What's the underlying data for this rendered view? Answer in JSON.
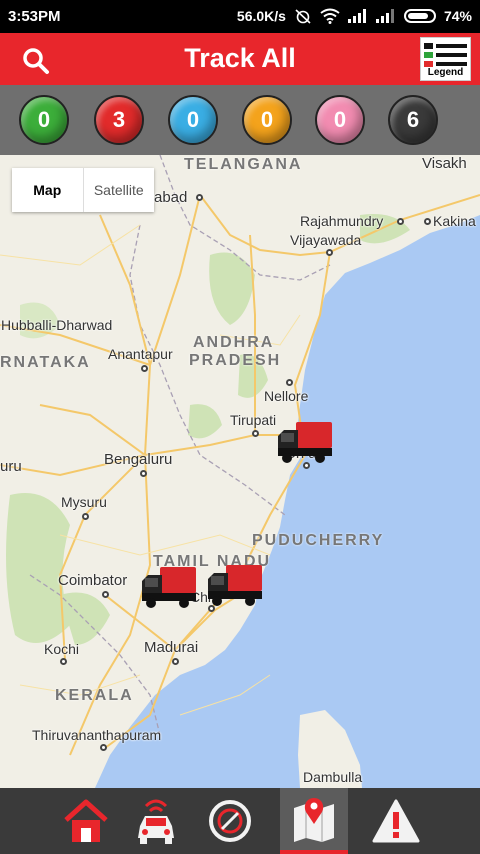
{
  "status_bar": {
    "time": "3:53PM",
    "network_speed": "56.0K/s",
    "battery": "74%",
    "icons": [
      "alarm-off-icon",
      "wifi-icon",
      "signal-icon",
      "signal-icon",
      "battery-icon"
    ]
  },
  "header": {
    "title": "Track All",
    "legend_label": "Legend",
    "search_icon": "search-icon",
    "legend_icon": "legend-icon"
  },
  "counts": [
    {
      "value": "0",
      "color": "#3cae3a"
    },
    {
      "value": "3",
      "color": "#e22b2b"
    },
    {
      "value": "0",
      "color": "#3aaee4"
    },
    {
      "value": "0",
      "color": "#f4a31c"
    },
    {
      "value": "0",
      "color": "#f28cb1"
    },
    {
      "value": "6",
      "color": "#3a3a3a"
    }
  ],
  "map": {
    "type_map": "Map",
    "type_satellite": "Satellite",
    "labels": {
      "telangana": "TELANGANA",
      "visakh": "Visakh",
      "abad": "abad",
      "rajahmundry": "Rajahmundry",
      "kakina": "Kakina",
      "vijayawada": "Vijayawada",
      "hubballi": "Hubballi-Dharwad",
      "anantapur": "Anantapur",
      "andhra": "ANDHRA",
      "pradesh": "PRADESH",
      "rnataka": "RNATAKA",
      "nellore": "Nellore",
      "tirupati": "Tirupati",
      "chennai_partial": "Ch    ai",
      "uru": "uru",
      "bengaluru": "Bengaluru",
      "mysuru": "Mysuru",
      "puducherry": "PUDUCHERRY",
      "tamil_nadu": "TAMIL NADU",
      "coimbatore": "Coimbator",
      "chi": "Chi",
      "kochi": "Kochi",
      "madurai": "Madurai",
      "kerala": "KERALA",
      "thiruvananthapuram": "Thiruvananthapuram",
      "dambulla": "Dambulla"
    },
    "vehicles": 3
  },
  "bottom_nav": [
    {
      "name": "home",
      "icon": "home-icon",
      "active": false
    },
    {
      "name": "live-tracking",
      "icon": "car-signal-icon",
      "active": false
    },
    {
      "name": "speed",
      "icon": "compass-icon",
      "active": false
    },
    {
      "name": "map",
      "icon": "map-pin-icon",
      "active": true
    },
    {
      "name": "alerts",
      "icon": "warning-icon",
      "active": false
    }
  ]
}
